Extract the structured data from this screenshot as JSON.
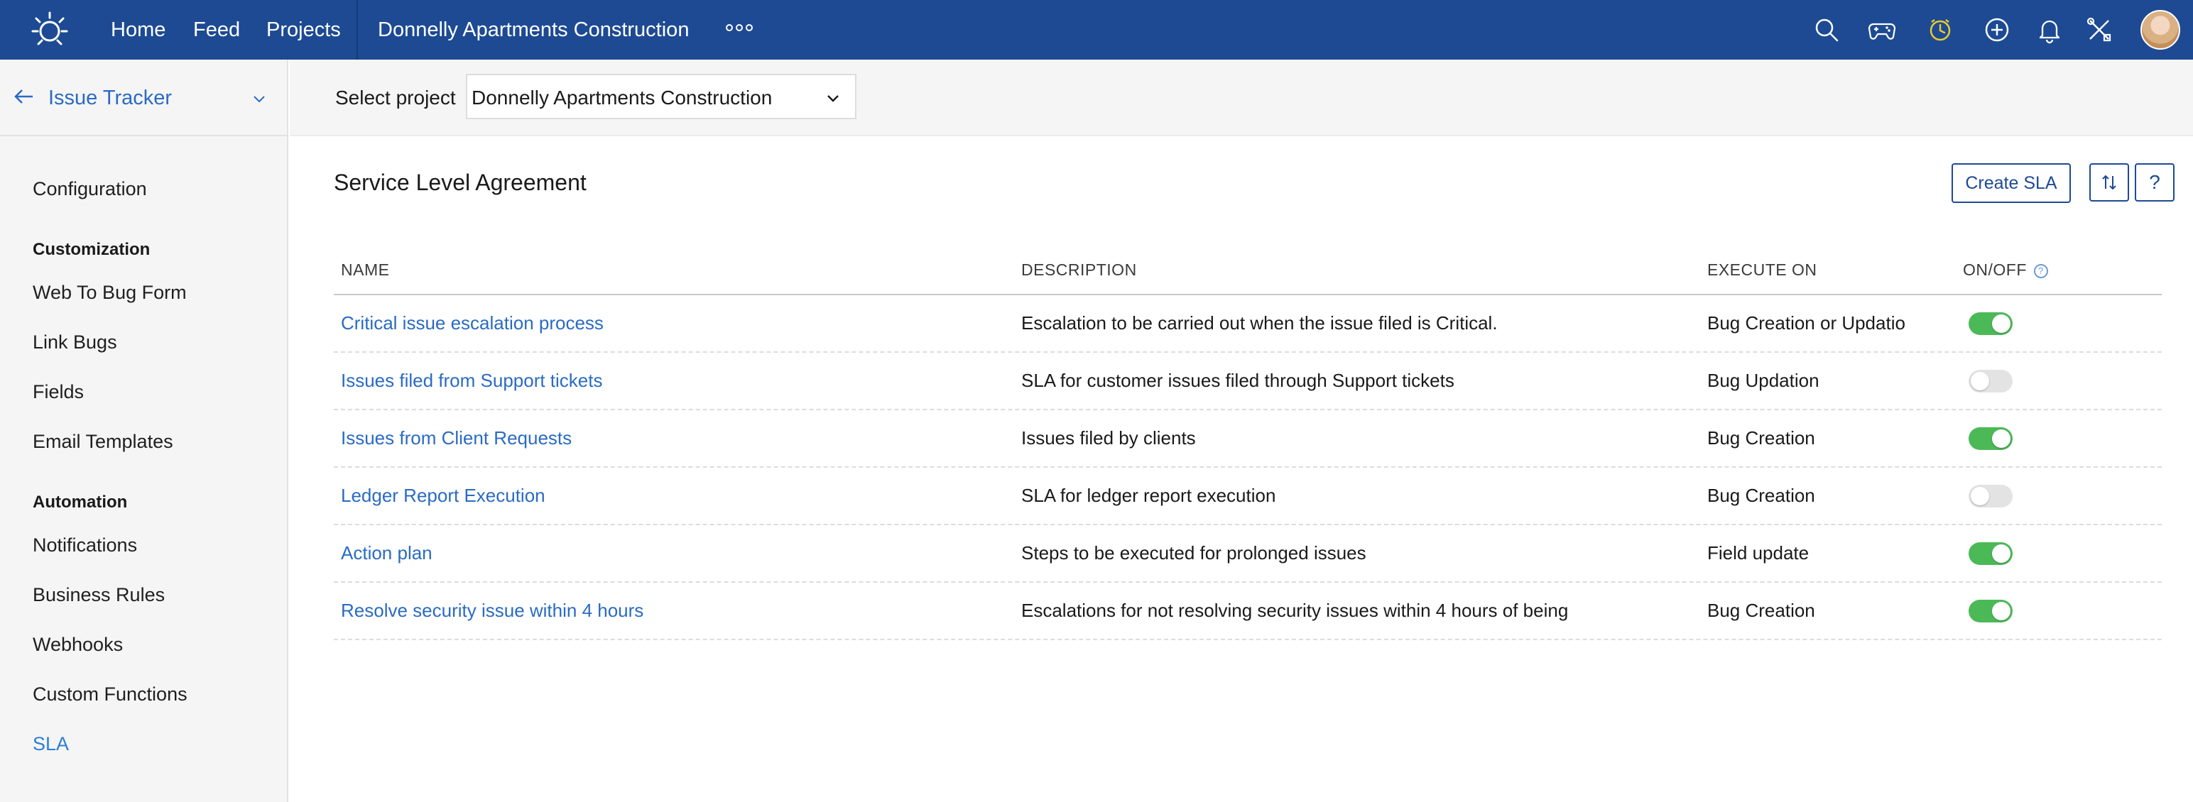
{
  "topbar": {
    "nav": [
      "Home",
      "Feed",
      "Projects"
    ],
    "project_title": "Donnelly Apartments Construction",
    "icons": [
      "search-icon",
      "gamepad-icon",
      "clock-icon",
      "plus-circle-icon",
      "bell-icon",
      "tools-icon"
    ]
  },
  "sidebar": {
    "title": "Issue Tracker",
    "items": {
      "configuration": "Configuration",
      "customization_header": "Customization",
      "web_to_bug_form": "Web To Bug Form",
      "link_bugs": "Link Bugs",
      "fields": "Fields",
      "email_templates": "Email Templates",
      "automation_header": "Automation",
      "notifications": "Notifications",
      "business_rules": "Business Rules",
      "webhooks": "Webhooks",
      "custom_functions": "Custom Functions",
      "sla": "SLA"
    }
  },
  "project_selector": {
    "label": "Select project",
    "value": "Donnelly Apartments Construction"
  },
  "main": {
    "title": "Service Level Agreement",
    "create_button": "Create SLA",
    "help_button": "?"
  },
  "table": {
    "headers": {
      "name": "NAME",
      "description": "DESCRIPTION",
      "execute_on": "EXECUTE ON",
      "on_off": "ON/OFF"
    },
    "rows": [
      {
        "name": "Critical issue escalation process",
        "description": "Escalation to be carried out when the issue filed is Critical.",
        "execute_on": "Bug Creation or Updatio",
        "enabled": true
      },
      {
        "name": "Issues filed from Support tickets",
        "description": "SLA for customer issues filed through Support tickets",
        "execute_on": "Bug Updation",
        "enabled": false
      },
      {
        "name": "Issues from Client Requests",
        "description": "Issues filed by clients",
        "execute_on": "Bug Creation",
        "enabled": true
      },
      {
        "name": "Ledger Report Execution",
        "description": "SLA for ledger report execution",
        "execute_on": "Bug Creation",
        "enabled": false
      },
      {
        "name": "Action plan",
        "description": "Steps to be executed for prolonged issues",
        "execute_on": "Field update",
        "enabled": true
      },
      {
        "name": "Resolve security issue within 4 hours",
        "description": "Escalations for not resolving security issues within 4 hours of being",
        "execute_on": "Bug Creation",
        "enabled": true
      }
    ]
  },
  "colors": {
    "topbar": "#1d4a93",
    "link": "#2a6bc3",
    "toggle_on": "#4cb957",
    "toggle_off": "#e3e3e3",
    "clock_accent": "#e8c832"
  }
}
